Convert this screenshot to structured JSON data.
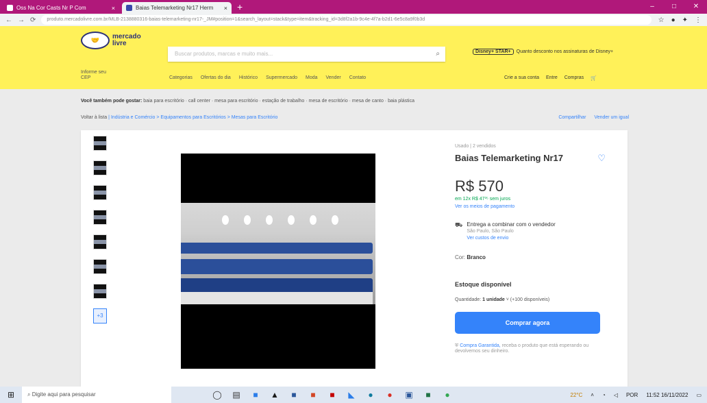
{
  "browser": {
    "tabs": [
      {
        "label": "Oss Na Cor Casts Nr P Com"
      },
      {
        "label": "Baias Telemarketing Nr17 Herm"
      }
    ],
    "new_tab": "+",
    "url": "produto.mercadolivre.com.br/MLB-2138880316-baias-telemarketing-nr17-_JM#position=1&search_layout=stack&type=item&tracking_id=3d8f2a1b-9c4e-4f7a-b2d1-6e5c8a9f0b3d",
    "minimize": "–",
    "maximize": "□",
    "close": "✕"
  },
  "header": {
    "logo_text_1": "mercado",
    "logo_text_2": "livre",
    "search_placeholder": "Buscar produtos, marcas e muito mais...",
    "promo_badge": "Disney+ STAR+",
    "promo_text": "Quanto desconto nos assinaturas de Disney+",
    "location_line1": "Informe seu",
    "location_line2": "CEP",
    "categories": [
      "Categorias",
      "Ofertas do dia",
      "Histórico",
      "Supermercado",
      "Moda",
      "Vender",
      "Contato"
    ],
    "user_nav": [
      "Crie a sua conta",
      "Entre",
      "Compras"
    ],
    "cart": "🛒"
  },
  "breadcrumbs": {
    "related_label": "Você também pode gostar:",
    "related": "baia para escritório · call center · mesa para escritório · estação de trabalho · mesa de escritório · mesa de canto · baia plástica",
    "back": "Voltar à lista",
    "path": "Indústria e Comércio > Equipamentos para Escritórios > Mesas para Escritório",
    "sell_one": "Vender um igual",
    "share": "Compartilhar"
  },
  "product": {
    "condition": "Usado | 2 vendidos",
    "title": "Baias Telemarketing Nr17",
    "price": "R$ 570",
    "installments": "em 12x R$ 47³⁵ sem juros",
    "payment_link": "Ver os meios de pagamento",
    "shipping_title": "Entrega a combinar com o vendedor",
    "shipping_location": "São Paulo, São Paulo",
    "shipping_link": "Ver custos de envio",
    "color_label": "Cor:",
    "color_value": "Branco",
    "stock": "Estoque disponível",
    "qty_label": "Quantidade:",
    "qty_value": "1 unidade",
    "qty_available": "(+100 disponíveis)",
    "buy_button": "Comprar agora",
    "guarantee_link": "Compra Garantida,",
    "guarantee_text": "receba o produto que está esperando ou devolvemos seu dinheiro.",
    "more_photos": "+3",
    "thumbnail_count": 7
  },
  "taskbar": {
    "search_placeholder": "Digite aqui para pesquisar",
    "temperature": "22°C",
    "time": "11:52",
    "date": "16/11/2022",
    "language": "POR"
  },
  "colors": {
    "brand_yellow": "#fff159",
    "accent_blue": "#3483fa",
    "tab_bar": "#b0187a"
  }
}
